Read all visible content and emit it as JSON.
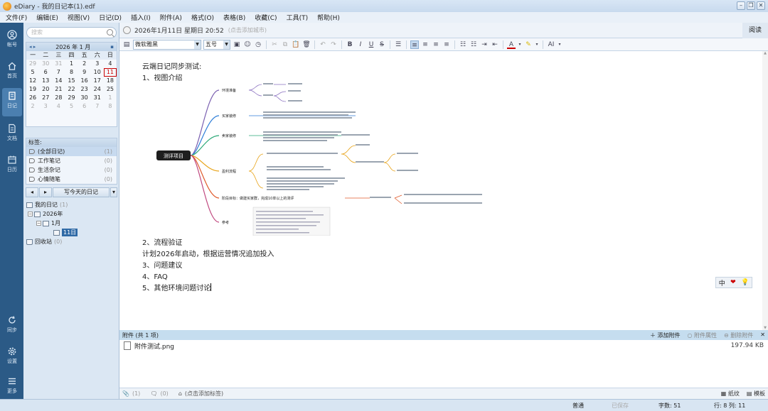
{
  "window": {
    "title": "eDiary - 我的日记本(1).edf"
  },
  "menu": [
    "文件(F)",
    "编辑(E)",
    "视图(V)",
    "日记(D)",
    "插入(I)",
    "附件(A)",
    "格式(O)",
    "表格(B)",
    "收藏(C)",
    "工具(T)",
    "帮助(H)"
  ],
  "rail": {
    "account": "帐号",
    "home": "首页",
    "diary": "日记",
    "docs": "文档",
    "calendar": "日历",
    "sync": "同步",
    "settings": "设置",
    "more": "更多"
  },
  "sidebar": {
    "search_placeholder": "搜索",
    "calendar": {
      "title": "2026 年 1 月",
      "weekdays": [
        "一",
        "二",
        "三",
        "四",
        "五",
        "六",
        "日"
      ],
      "days": [
        [
          "29",
          "30",
          "31",
          "1",
          "2",
          "3",
          "4"
        ],
        [
          "5",
          "6",
          "7",
          "8",
          "9",
          "10",
          "11"
        ],
        [
          "12",
          "13",
          "14",
          "15",
          "16",
          "17",
          "18"
        ],
        [
          "19",
          "20",
          "21",
          "22",
          "23",
          "24",
          "25"
        ],
        [
          "26",
          "27",
          "28",
          "29",
          "30",
          "31",
          "1"
        ],
        [
          "2",
          "3",
          "4",
          "5",
          "6",
          "7",
          "8"
        ]
      ]
    },
    "tags": {
      "header": "标签:",
      "items": [
        {
          "label": "(全部日记)",
          "count": "(1)"
        },
        {
          "label": "工作笔记",
          "count": "(0)"
        },
        {
          "label": "生活杂记",
          "count": "(0)"
        },
        {
          "label": "心情随笔",
          "count": "(0)"
        }
      ]
    },
    "write_today": "写今天的日记",
    "tree": {
      "root": "我的日记",
      "root_count": "(1)",
      "year": "2026年",
      "month": "1月",
      "day": "11日",
      "recycle": "回收站",
      "recycle_count": "(0)"
    }
  },
  "editor": {
    "date": "2026年1月11日 星期日 20:52",
    "location_placeholder": "(点击添加城市)",
    "read_button": "阅读",
    "font": "微软雅黑",
    "size": "五号",
    "lines": [
      "云端日记同步测试:",
      "1、视图介绍",
      "2、流程验证",
      "计划2026年启动，根据运营情况追加投入",
      "3、问题建议",
      "4、FAQ",
      "5、其他环境问题讨论"
    ],
    "mindmap": {
      "center": "测评项目",
      "branches": [
        "环境准备",
        "买家装修",
        "卖家装修",
        "盈利流程",
        "阶段目标：做建买家群，完成10单以上的测评",
        "参考"
      ]
    }
  },
  "ime": [
    "中",
    "❤",
    "💡"
  ],
  "attachments": {
    "header": "附件 (共 1 项)",
    "add": "添加附件",
    "props": "附件属性",
    "delete": "删除附件",
    "files": [
      {
        "name": "附件测试.png",
        "size": "197.94 KB"
      }
    ]
  },
  "tagbar": {
    "attach_count": "(1)",
    "comment_count": "(0)",
    "add_tag": "(点击添加标签)",
    "paper": "纸纹",
    "template": "模板"
  },
  "status": {
    "mode": "普通",
    "saved": "已保存",
    "words": "字数: 51",
    "pos": "行: 8  列: 11"
  },
  "colors": {
    "rail": "#2b5a86",
    "accent": "#2f6aa6",
    "today": "#cc0000"
  }
}
